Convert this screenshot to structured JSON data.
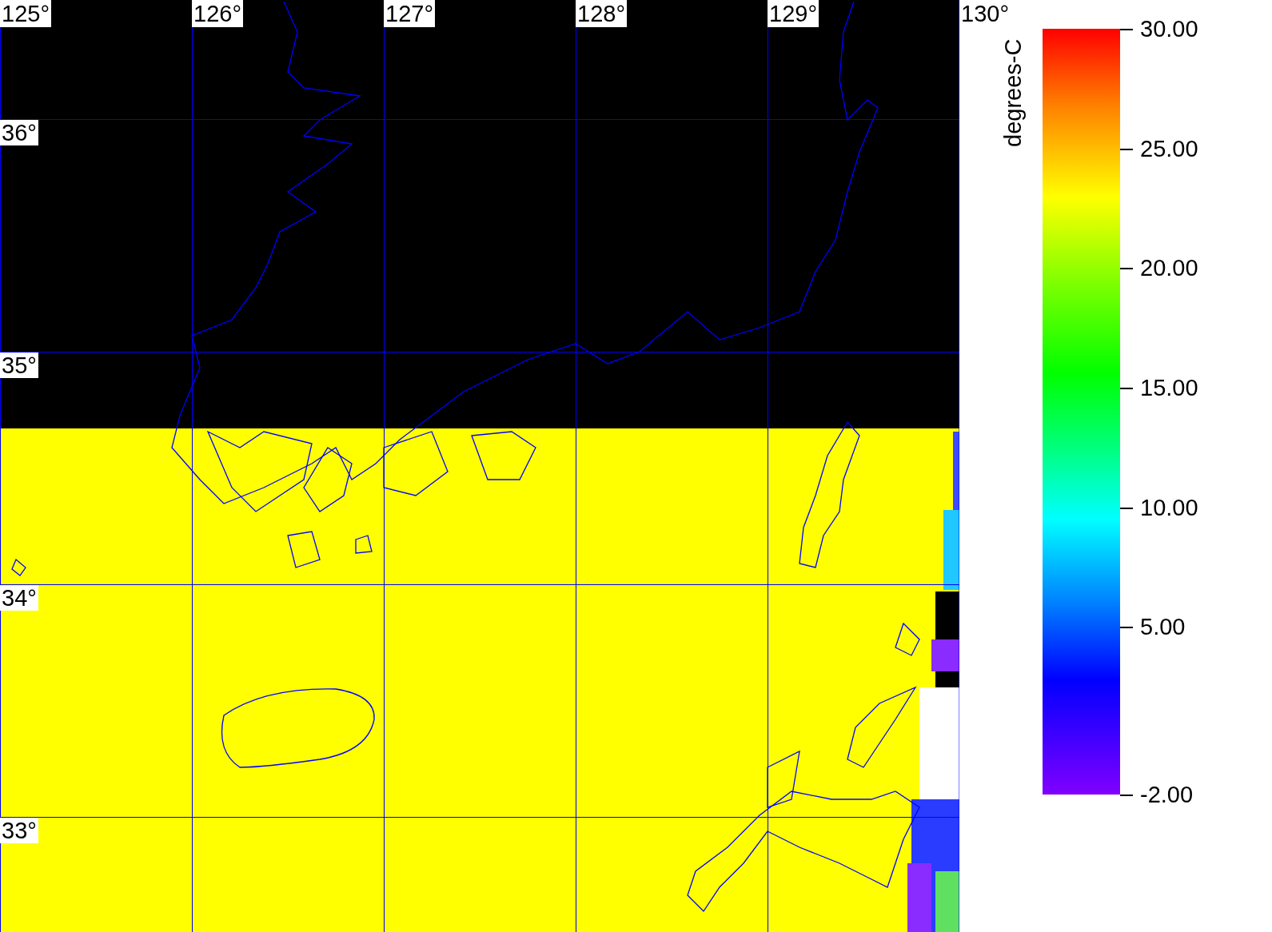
{
  "map": {
    "longitude_labels": [
      "125°",
      "126°",
      "127°",
      "128°",
      "129°",
      "130°"
    ],
    "latitude_labels": [
      "36°",
      "35°",
      "34°",
      "33°"
    ]
  },
  "colorbar": {
    "title": "degrees-C",
    "tick_labels": [
      "30.00",
      "25.00",
      "20.00",
      "15.00",
      "10.00",
      "5.00",
      "-2.00"
    ]
  }
}
